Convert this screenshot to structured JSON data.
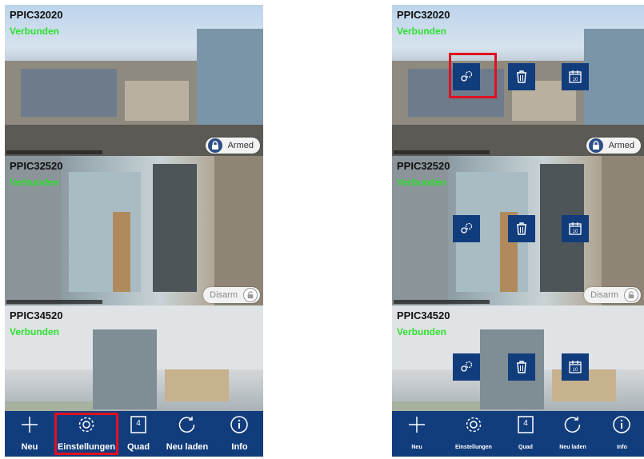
{
  "cameras": [
    {
      "name": "PPIC32020",
      "status": "Verbunden",
      "security": "Armed"
    },
    {
      "name": "PPIC32520",
      "status": "Verbunden",
      "security": "Disarm"
    },
    {
      "name": "PPIC34520",
      "status": "Verbunden"
    }
  ],
  "toolbar": {
    "add_label": "Neu",
    "settings_label": "Einstellungen",
    "quad_label": "Quad",
    "quad_number": "4",
    "reload_label": "Neu laden",
    "info_label": "Info"
  },
  "calendar_number": "10",
  "colors": {
    "accent": "#123d7d",
    "connected": "#2ee02e",
    "highlight": "#e01020"
  }
}
